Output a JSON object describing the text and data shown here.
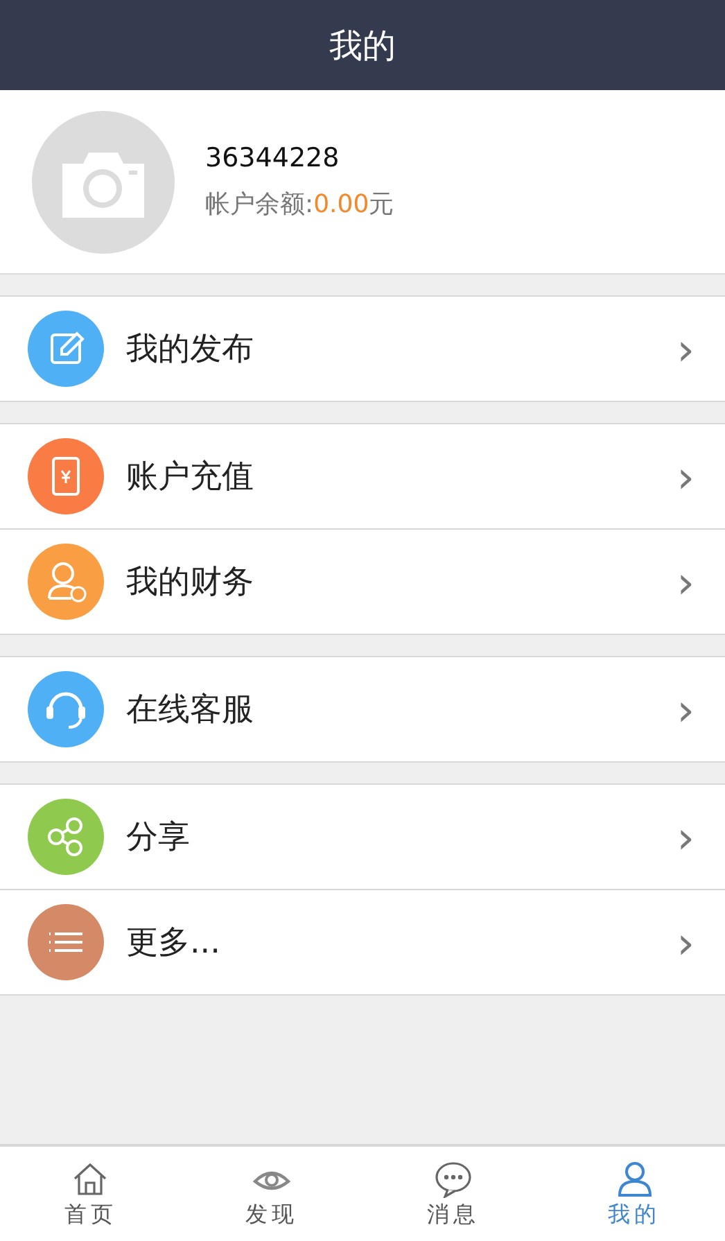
{
  "header": {
    "title": "我的"
  },
  "profile": {
    "user_id": "36344228",
    "balance_label": "帐户余额:",
    "balance_value": "0.00",
    "balance_unit": "元"
  },
  "menu_groups": [
    [
      {
        "label": "我的发布",
        "kind": "edit",
        "color": "#4fb0f5",
        "chevron": "›"
      }
    ],
    [
      {
        "label": "账户充值",
        "kind": "phone",
        "color": "#f97c45",
        "chevron": "›"
      },
      {
        "label": "我的财务",
        "kind": "finance",
        "color": "#fa9e43",
        "chevron": "›"
      }
    ],
    [
      {
        "label": "在线客服",
        "kind": "headset",
        "color": "#4fb0f5",
        "chevron": "›"
      }
    ],
    [
      {
        "label": "分享",
        "kind": "share",
        "color": "#8fca4f",
        "chevron": "›"
      },
      {
        "label": "更多...",
        "kind": "list",
        "color": "#d48a66",
        "chevron": "›"
      }
    ]
  ],
  "tab_bar": [
    {
      "label": "首页",
      "kind": "home",
      "selected": false
    },
    {
      "label": "发现",
      "kind": "eye",
      "selected": false
    },
    {
      "label": "消息",
      "kind": "chat",
      "selected": false
    },
    {
      "label": "我的",
      "kind": "person",
      "selected": true
    }
  ]
}
